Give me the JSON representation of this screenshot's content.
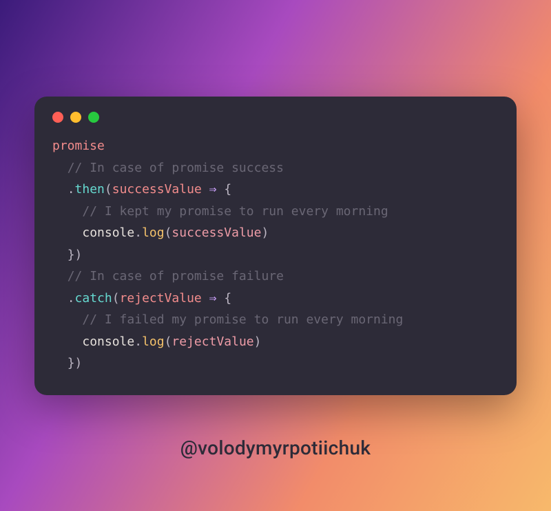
{
  "colors": {
    "window_bg": "#2d2b38",
    "red": "#ff5f56",
    "yellow": "#ffbd2e",
    "green": "#27c93f",
    "ident": "#f28c8c",
    "method": "#66d9d0",
    "method2": "#f5c26b",
    "comment": "#6a6775",
    "arrow": "#cfa3ff",
    "punct": "#bdb7c4"
  },
  "code": {
    "l1_promise": "promise",
    "l2_comment": "// In case of promise success",
    "l3_then": "then",
    "l3_arg": "successValue",
    "l3_arrow": "⇒",
    "l4_comment": "// I kept my promise to run every morning",
    "l5_console": "console",
    "l5_log": "log",
    "l5_arg": "successValue",
    "l6_close": "})",
    "l7_comment": "// In case of promise failure",
    "l8_catch": "catch",
    "l8_arg": "rejectValue",
    "l8_arrow": "⇒",
    "l9_comment": "// I failed my promise to run every morning",
    "l10_console": "console",
    "l10_log": "log",
    "l10_arg": "rejectValue",
    "l11_close": "})",
    "dot": ".",
    "lp": "(",
    "rp": ")",
    "lb": "{",
    "rb": "}"
  },
  "handle": "@volodymyrpotiichuk"
}
